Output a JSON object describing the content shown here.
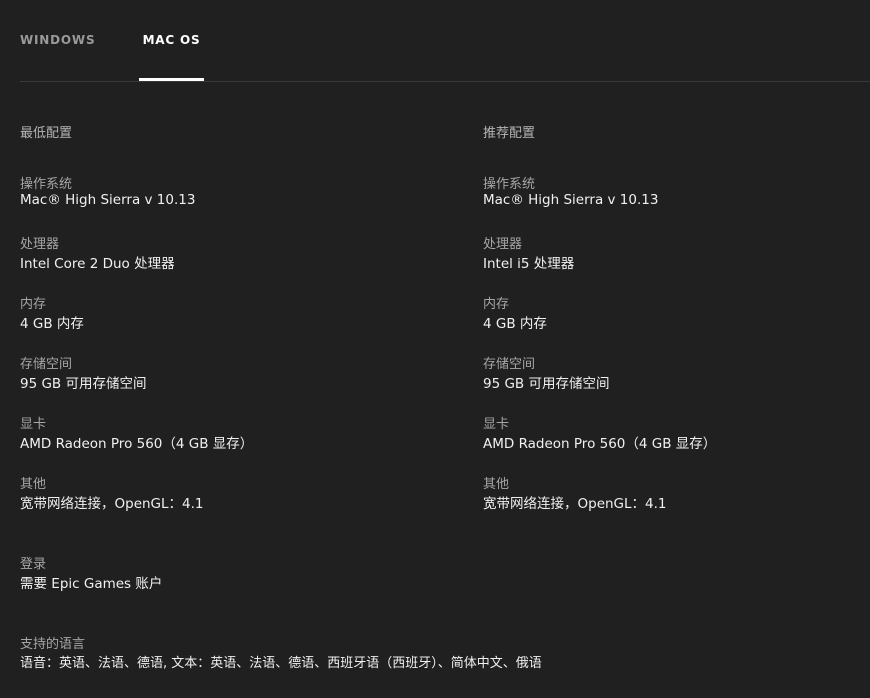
{
  "tabs": [
    {
      "label": "WINDOWS",
      "active": false
    },
    {
      "label": "MAC OS",
      "active": true
    }
  ],
  "minimum": {
    "header": "最低配置",
    "specs": [
      {
        "label": "操作系统",
        "value": "Mac® High Sierra v 10.13"
      },
      {
        "label": "处理器",
        "value": "Intel Core 2 Duo 处理器"
      },
      {
        "label": "内存",
        "value": "4 GB 内存"
      },
      {
        "label": "存储空间",
        "value": "95 GB 可用存储空间"
      },
      {
        "label": "显卡",
        "value": "AMD Radeon Pro 560（4 GB 显存）"
      },
      {
        "label": "其他",
        "value": "宽带网络连接，OpenGL：4.1"
      }
    ]
  },
  "recommended": {
    "header": "推荐配置",
    "specs": [
      {
        "label": "操作系统",
        "value": "Mac® High Sierra v 10.13"
      },
      {
        "label": "处理器",
        "value": "Intel i5 处理器"
      },
      {
        "label": "内存",
        "value": "4 GB 内存"
      },
      {
        "label": "存储空间",
        "value": "95 GB 可用存储空间"
      },
      {
        "label": "显卡",
        "value": "AMD Radeon Pro 560（4 GB 显存）"
      },
      {
        "label": "其他",
        "value": "宽带网络连接，OpenGL：4.1"
      }
    ]
  },
  "login": {
    "label": "登录",
    "value": "需要 Epic Games 账户"
  },
  "languages": {
    "label": "支持的语言",
    "value": "语音：英语、法语、德语, 文本：英语、法语、德语、西班牙语（西班牙）、简体中文、俄语"
  }
}
